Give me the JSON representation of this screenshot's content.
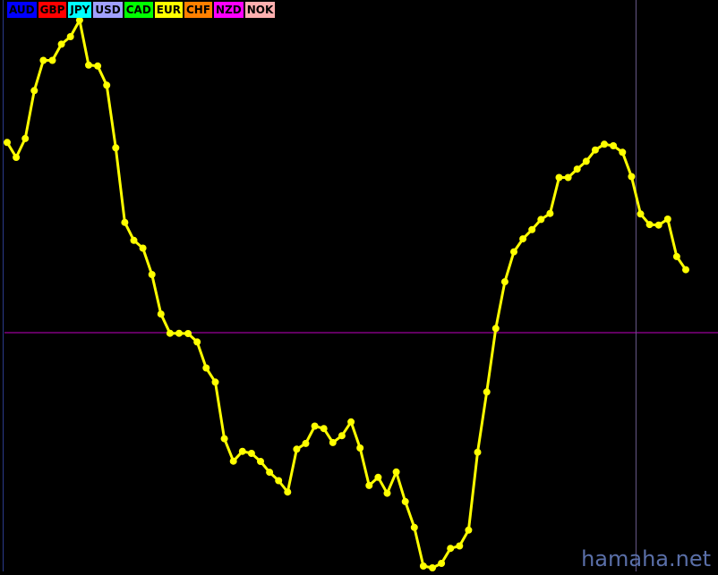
{
  "legend": [
    {
      "label": "AUD",
      "color": "#0000ff",
      "text_color": "#000000"
    },
    {
      "label": "GBP",
      "color": "#ff0000",
      "text_color": "#000000"
    },
    {
      "label": "JPY",
      "color": "#00ffff",
      "text_color": "#000000"
    },
    {
      "label": "USD",
      "color": "#a0a0ff",
      "text_color": "#000000"
    },
    {
      "label": "CAD",
      "color": "#00ff00",
      "text_color": "#000000"
    },
    {
      "label": "EUR",
      "color": "#ffff00",
      "text_color": "#000000"
    },
    {
      "label": "CHF",
      "color": "#ff8000",
      "text_color": "#000000"
    },
    {
      "label": "NZD",
      "color": "#ff00ff",
      "text_color": "#000000"
    },
    {
      "label": "NOK",
      "color": "#ffb0b0",
      "text_color": "#000000"
    }
  ],
  "watermark": "hamaha.net",
  "colors": {
    "background": "#000000",
    "series_line": "#ffff00",
    "zero_line": "#c000c0",
    "cursor_line": "#6a5a8a"
  },
  "chart_data": {
    "type": "line",
    "x_range": [
      0,
      78
    ],
    "ylim": [
      -100,
      100
    ],
    "zero_line": 0,
    "cursor_x": 69.5,
    "grid": false,
    "legend_placement": "top-left",
    "series": [
      {
        "name": "EUR",
        "color": "#ffff00",
        "x": [
          0,
          1,
          2,
          3,
          4,
          5,
          6,
          7,
          8,
          9,
          10,
          11,
          12,
          13,
          14,
          15,
          16,
          17,
          18,
          19,
          20,
          21,
          22,
          23,
          24,
          25,
          26,
          27,
          28,
          29,
          30,
          31,
          32,
          33,
          34,
          35,
          36,
          37,
          38,
          39,
          40,
          41,
          42,
          43,
          44,
          45,
          46,
          47,
          48,
          49,
          50,
          51,
          52,
          53,
          54,
          55,
          56,
          57,
          58,
          59,
          60,
          61,
          62,
          63,
          64,
          65,
          66,
          67,
          68,
          69,
          70,
          71,
          72,
          73,
          74,
          75
        ],
        "y": [
          63.5,
          58.5,
          64.8,
          80.8,
          90.9,
          90.9,
          96.3,
          98.8,
          104.3,
          89.3,
          89.0,
          82.6,
          61.7,
          36.8,
          30.8,
          28.2,
          19.4,
          6.2,
          -0.2,
          -0.2,
          -0.3,
          -3.1,
          -11.8,
          -16.5,
          -35.4,
          -42.9,
          -39.6,
          -40.3,
          -43.0,
          -46.6,
          -49.4,
          -53.2,
          -38.9,
          -37.0,
          -31.2,
          -32.0,
          -36.7,
          -34.4,
          -29.8,
          -38.5,
          -51.0,
          -48.3,
          -53.6,
          -46.5,
          -56.4,
          -65.0,
          -77.9,
          -78.5,
          -77.0,
          -72.0,
          -71.2,
          -65.9,
          -39.9,
          -19.8,
          1.4,
          17.0,
          27.0,
          31.3,
          34.4,
          37.8,
          39.8,
          51.8,
          51.8,
          54.6,
          57.2,
          61.0,
          62.9,
          62.4,
          60.2,
          52.1,
          39.6,
          36.1,
          35.9,
          37.9,
          25.4,
          21.0
        ]
      }
    ]
  }
}
